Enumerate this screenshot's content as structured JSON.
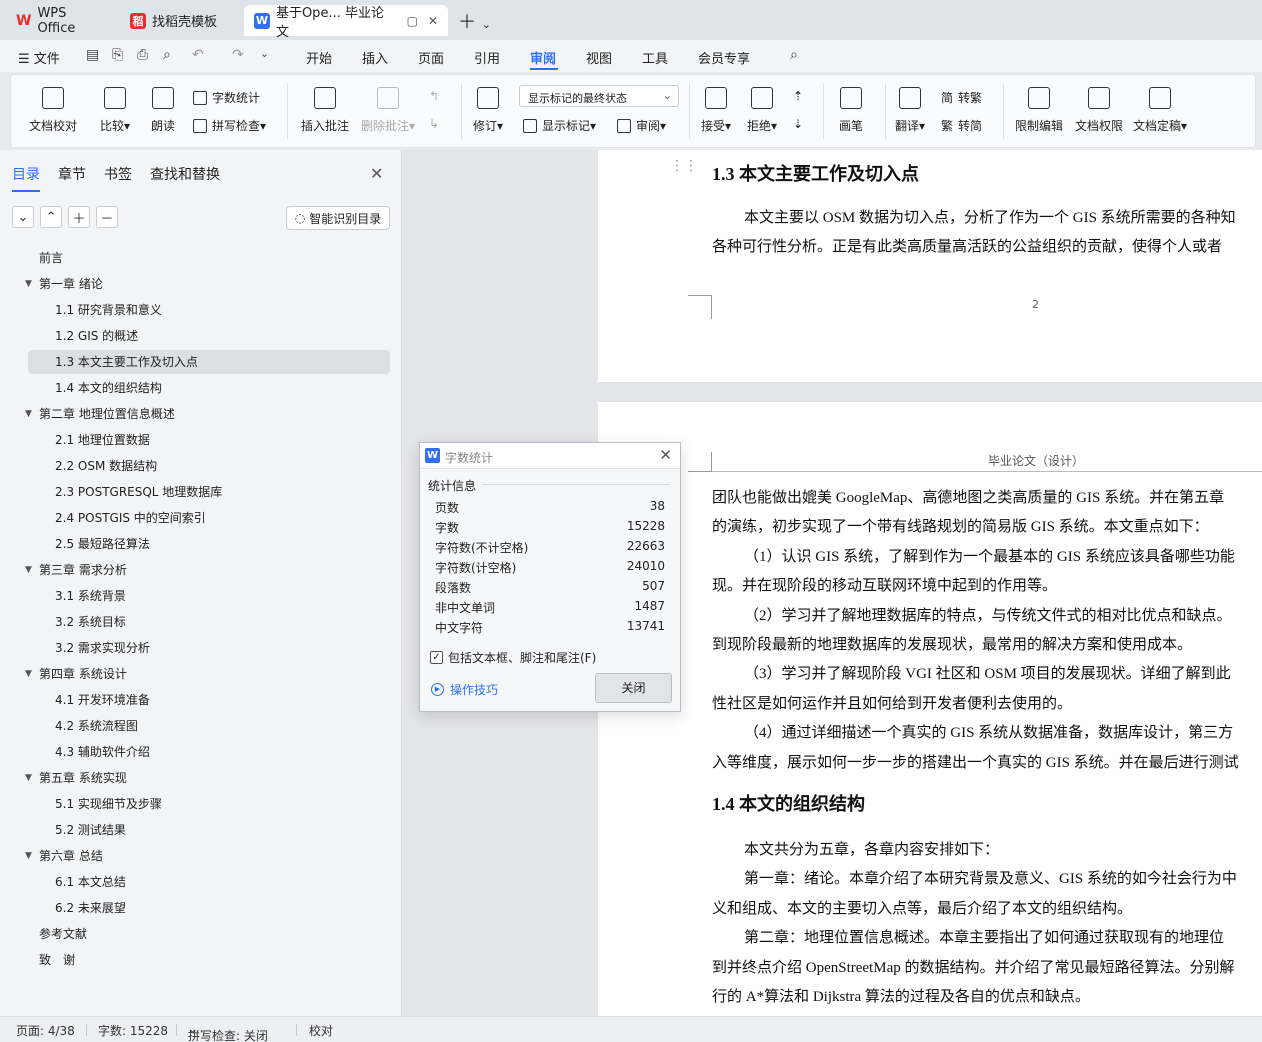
{
  "tabs": {
    "wps": "WPS Office",
    "template": "找稻壳模板",
    "doc": "基于Ope... 毕业论文"
  },
  "menu": {
    "file": "文件",
    "items": [
      "开始",
      "插入",
      "页面",
      "引用",
      "审阅",
      "视图",
      "工具",
      "会员专享"
    ],
    "active": "审阅"
  },
  "ribbon": {
    "doc_check": "文档校对",
    "compare": "比较",
    "read_aloud": "朗读",
    "word_count": "字数统计",
    "spell_check": "拼写检查",
    "insert_comment": "插入批注",
    "delete_comment": "删除批注",
    "revise": "修订",
    "display_mode": "显示标记的最终状态",
    "show_markup": "显示标记",
    "review": "审阅",
    "accept": "接受",
    "reject": "拒绝",
    "pen": "画笔",
    "translate": "翻译",
    "to_traditional": "转繁",
    "to_simplified": "转简",
    "restrict_edit": "限制编辑",
    "doc_permission": "文档权限",
    "doc_finalize": "文档定稿"
  },
  "nav": {
    "tabs": [
      "目录",
      "章节",
      "书签",
      "查找和替换"
    ],
    "smart_toc": "智能识别目录",
    "toc": [
      {
        "label": "前言",
        "level": 0,
        "caret": false
      },
      {
        "label": "第一章 绪论",
        "level": 0,
        "caret": true
      },
      {
        "label": "1.1 研究背景和意义",
        "level": 1,
        "caret": false
      },
      {
        "label": "1.2 GIS 的概述",
        "level": 1,
        "caret": false
      },
      {
        "label": "1.3 本文主要工作及切入点",
        "level": 1,
        "caret": false,
        "selected": true
      },
      {
        "label": "1.4 本文的组织结构",
        "level": 1,
        "caret": false
      },
      {
        "label": "第二章 地理位置信息概述",
        "level": 0,
        "caret": true
      },
      {
        "label": "2.1 地理位置数据",
        "level": 1,
        "caret": false
      },
      {
        "label": "2.2 OSM 数据结构",
        "level": 1,
        "caret": false
      },
      {
        "label": "2.3 POSTGRESQL 地理数据库",
        "level": 1,
        "caret": false
      },
      {
        "label": "2.4 POSTGIS 中的空间索引",
        "level": 1,
        "caret": false
      },
      {
        "label": "2.5 最短路径算法",
        "level": 1,
        "caret": false
      },
      {
        "label": "第三章 需求分析",
        "level": 0,
        "caret": true
      },
      {
        "label": "3.1 系统背景",
        "level": 1,
        "caret": false
      },
      {
        "label": "3.2 系统目标",
        "level": 1,
        "caret": false
      },
      {
        "label": "3.2 需求实现分析",
        "level": 1,
        "caret": false
      },
      {
        "label": "第四章 系统设计",
        "level": 0,
        "caret": true
      },
      {
        "label": "4.1 开发环境准备",
        "level": 1,
        "caret": false
      },
      {
        "label": "4.2 系统流程图",
        "level": 1,
        "caret": false
      },
      {
        "label": "4.3 辅助软件介绍",
        "level": 1,
        "caret": false
      },
      {
        "label": "第五章 系统实现",
        "level": 0,
        "caret": true
      },
      {
        "label": "5.1 实现细节及步骤",
        "level": 1,
        "caret": false
      },
      {
        "label": "5.2 测试结果",
        "level": 1,
        "caret": false
      },
      {
        "label": "第六章 总结",
        "level": 0,
        "caret": true
      },
      {
        "label": "6.1 本文总结",
        "level": 1,
        "caret": false
      },
      {
        "label": "6.2 未来展望",
        "level": 1,
        "caret": false
      },
      {
        "label": "参考文献",
        "level": 0,
        "caret": false
      },
      {
        "label": "致　谢",
        "level": 0,
        "caret": false
      }
    ]
  },
  "document": {
    "page1": {
      "heading": "1.3 本文主要工作及切入点",
      "lines": [
        "本文主要以 OSM 数据为切入点，分析了作为一个 GIS 系统所需要的各种知",
        "各种可行性分析。正是有此类高质量高活跃的公益组织的贡献，使得个人或者"
      ],
      "page_number": "2"
    },
    "page2": {
      "header": "毕业论文（设计）",
      "lines": [
        "团队也能做出媲美 GoogleMap、高德地图之类高质量的 GIS 系统。并在第五章",
        "的演练，初步实现了一个带有线路规划的简易版 GIS 系统。本文重点如下：",
        "（1）认识 GIS 系统，了解到作为一个最基本的 GIS 系统应该具备哪些功能",
        "现。并在现阶段的移动互联网环境中起到的作用等。",
        "（2）学习并了解地理数据库的特点，与传统文件式的相对比优点和缺点。",
        "到现阶段最新的地理数据库的发展现状，最常用的解决方案和使用成本。",
        "（3）学习并了解现阶段 VGI 社区和 OSM 项目的发展现状。详细了解到此",
        "性社区是如何运作并且如何给到开发者便利去使用的。",
        "（4）通过详细描述一个真实的 GIS 系统从数据准备，数据库设计，第三方",
        "入等维度，展示如何一步一步的搭建出一个真实的 GIS 系统。并在最后进行测试"
      ],
      "heading": "1.4 本文的组织结构",
      "lines2": [
        "本文共分为五章，各章内容安排如下：",
        "第一章：绪论。本章介绍了本研究背景及意义、GIS 系统的如今社会行为中",
        "义和组成、本文的主要切入点等，最后介绍了本文的组织结构。",
        "第二章：地理位置信息概述。本章主要指出了如何通过获取现有的地理位",
        "到并终点介绍 OpenStreetMap 的数据结构。并介绍了常见最短路径算法。分别解",
        "行的 A*算法和 Dijkstra 算法的过程及各自的优点和缺点。"
      ]
    }
  },
  "dialog": {
    "title": "字数统计",
    "section": "统计信息",
    "stats": [
      {
        "label": "页数",
        "value": "38"
      },
      {
        "label": "字数",
        "value": "15228"
      },
      {
        "label": "字符数(不计空格)",
        "value": "22663"
      },
      {
        "label": "字符数(计空格)",
        "value": "24010"
      },
      {
        "label": "段落数",
        "value": "507"
      },
      {
        "label": "非中文单词",
        "value": "1487"
      },
      {
        "label": "中文字符",
        "value": "13741"
      }
    ],
    "checkbox": "包括文本框、脚注和尾注(F)",
    "checked": true,
    "tips": "操作技巧",
    "close": "关闭"
  },
  "status": {
    "page": "页面: 4/38",
    "words": "字数: 15228",
    "spell": "拼写检查: 关闭",
    "proof": "校对"
  },
  "colors": {
    "accent": "#2f6ff0",
    "wps_red": "#e0302e"
  }
}
